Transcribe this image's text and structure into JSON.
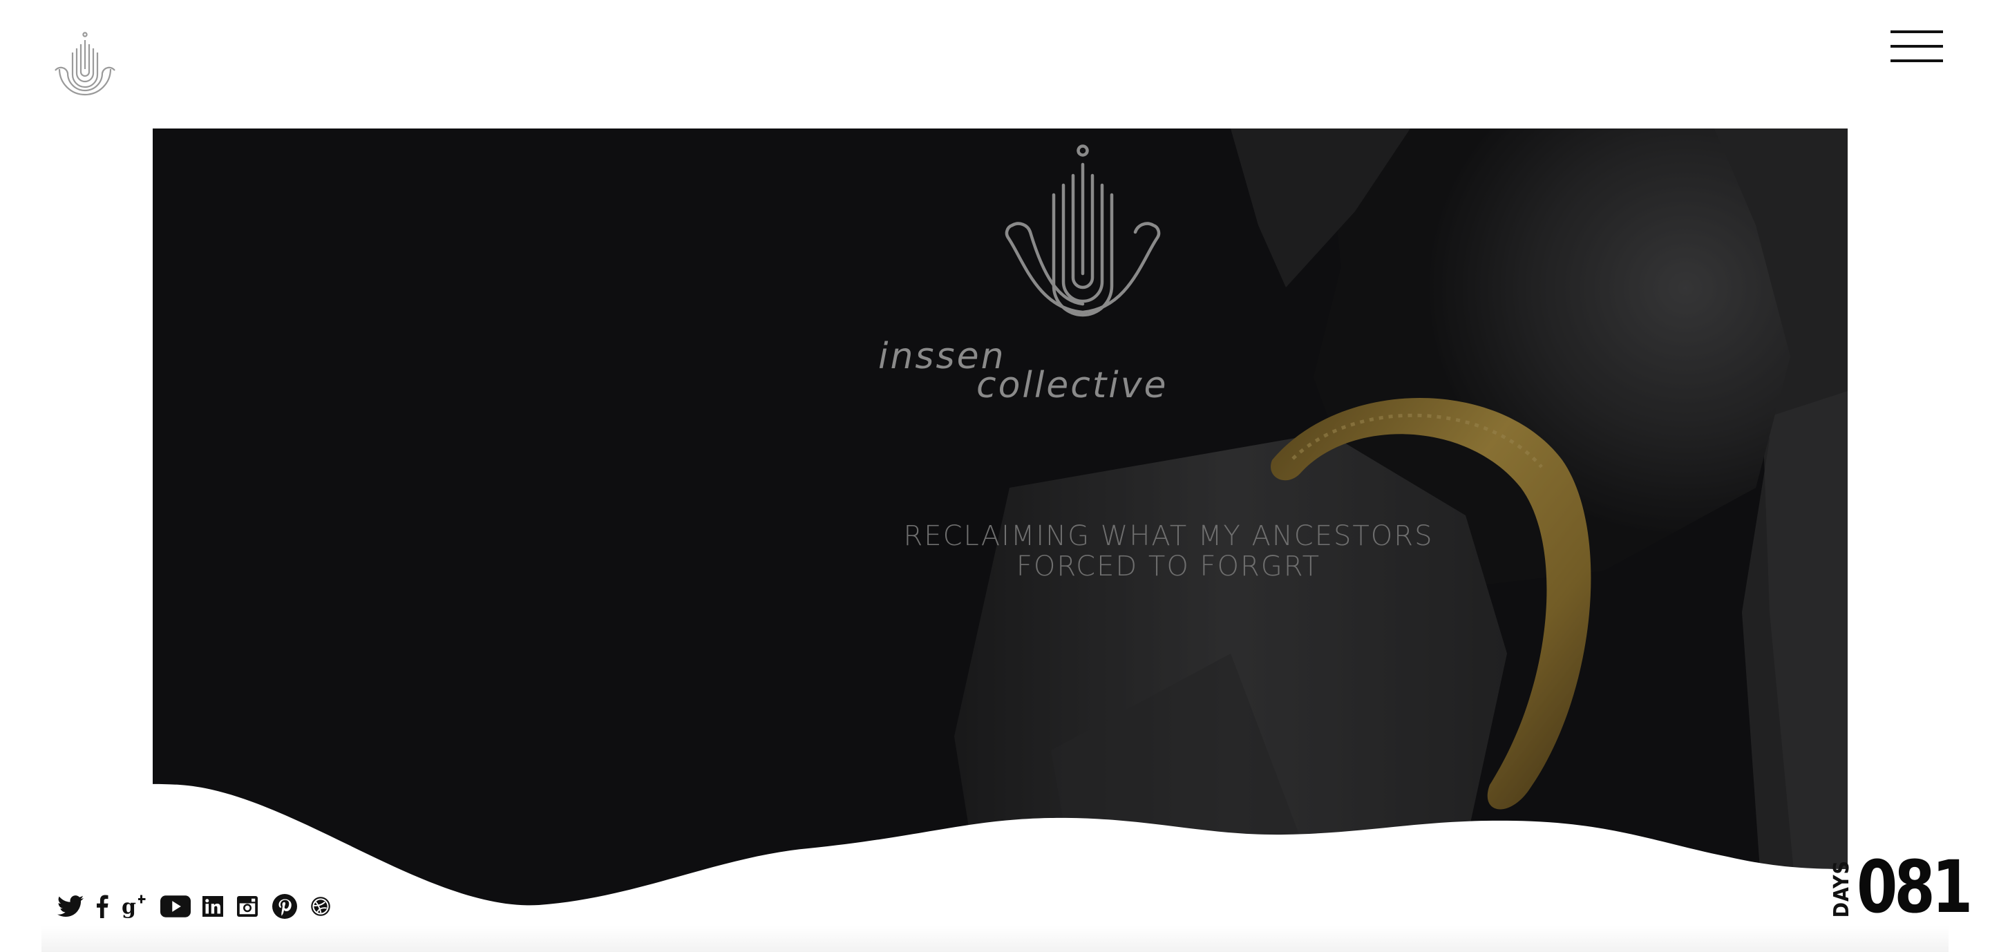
{
  "brand": {
    "name_line1": "inssen",
    "name_line2": "collective"
  },
  "hero": {
    "tagline_line1": "RECLAIMING WHAT MY ANCESTORS",
    "tagline_line2": "FORCED TO FORGRT"
  },
  "social": [
    {
      "name": "twitter-icon"
    },
    {
      "name": "facebook-icon"
    },
    {
      "name": "google-plus-icon"
    },
    {
      "name": "youtube-icon"
    },
    {
      "name": "linkedin-icon"
    },
    {
      "name": "instagram-icon"
    },
    {
      "name": "pinterest-icon"
    },
    {
      "name": "dribbble-icon"
    }
  ],
  "counter": {
    "label": "DAYS",
    "value": "081"
  },
  "colors": {
    "hero_bg": "#0f0f10",
    "tagline": "#6f6f6f",
    "logo_stroke": "#8a8a8a",
    "bangle": "#b8963a"
  }
}
